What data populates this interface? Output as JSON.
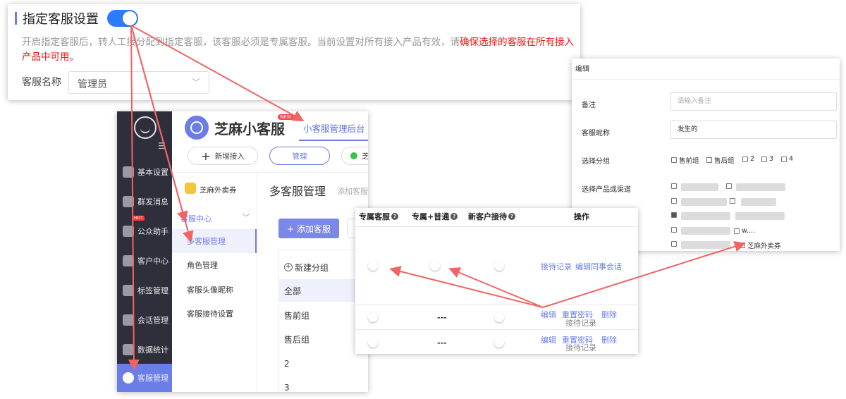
{
  "top_panel": {
    "title": "指定客服设置",
    "description_gray": "开启指定客服后，转人工接分配到指定客服，该客服必须是专属客服。当前设置对所有接入产品有效，请",
    "description_red": "确保选择的客服在所有接入产品中可用。",
    "field_label": "客服名称",
    "select_value": "管理员",
    "toggle_on": true
  },
  "app": {
    "sidebar": [
      {
        "label": "基本设置",
        "icon": "grid-icon"
      },
      {
        "label": "群发消息",
        "icon": "send-icon"
      },
      {
        "label": "公众助手",
        "icon": "wechat-icon",
        "badge": "HOT"
      },
      {
        "label": "客户中心",
        "icon": "users-icon"
      },
      {
        "label": "标签管理",
        "icon": "tag-icon"
      },
      {
        "label": "会话管理",
        "icon": "chat-icon"
      },
      {
        "label": "数据统计",
        "icon": "chart-icon"
      },
      {
        "label": "客服管理",
        "icon": "robot-icon",
        "active": true
      }
    ],
    "brand_name": "芝麻小客服",
    "new_badge": "NEW",
    "header_tab": "小客服管理后台",
    "toolbar": {
      "new_access": "新增接入",
      "manage": "管理",
      "wx_tab": "芝"
    },
    "shop_name": "芝麻外卖券",
    "service_center": "客服中心",
    "sub_nav": [
      "多客服管理",
      "角色管理",
      "客服头像昵称",
      "客服接待设置"
    ],
    "page_title": "多客服管理",
    "page_subtitle": "添加客服",
    "add_button": "+ 添加客服",
    "new_group": "新建分组",
    "groups": [
      "全部",
      "售前组",
      "售后组",
      "2",
      "3"
    ]
  },
  "edit_panel": {
    "title": "编辑",
    "remark_label": "备注",
    "remark_placeholder": "请输入备注",
    "nickname_label": "客服昵称",
    "nickname_value": "发生的",
    "group_label": "选择分组",
    "group_options": [
      "售前组",
      "售后组",
      "2",
      "3",
      "4"
    ],
    "product_label": "选择产品或渠道",
    "product_visible": "芝麻外卖券",
    "product_partial": "w...."
  },
  "table": {
    "headers": [
      "专属客服",
      "专属+普通",
      "新客户接待",
      "操作"
    ],
    "row1_actions": [
      "接待记录",
      "编辑同事会话"
    ],
    "row_actions": [
      "编辑",
      "重置密码",
      "删除"
    ],
    "row_sub_action": "接待记录",
    "dash": "---"
  }
}
